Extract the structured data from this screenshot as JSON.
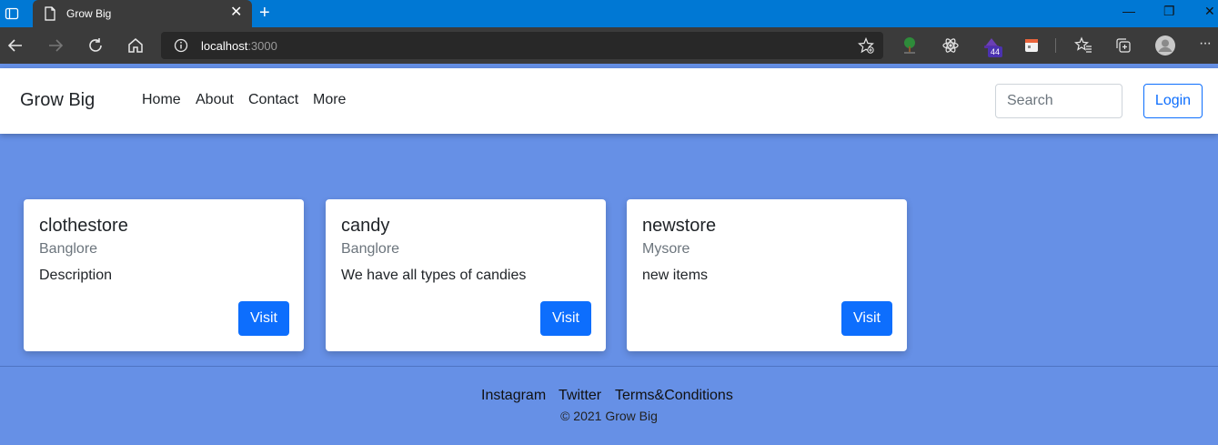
{
  "browser": {
    "tab_title": "Grow Big",
    "tab_close": "✕",
    "new_tab": "+",
    "url_host": "localhost",
    "url_port": ":3000",
    "extension_badge": "44",
    "window_controls": {
      "minimize": "—",
      "restore": "❐",
      "close": "✕"
    },
    "more": "···"
  },
  "navbar": {
    "brand": "Grow Big",
    "links": [
      "Home",
      "About",
      "Contact",
      "More"
    ],
    "search_placeholder": "Search",
    "login": "Login"
  },
  "cards": [
    {
      "title": "clothestore",
      "location": "Banglore",
      "description": "Description",
      "button": "Visit"
    },
    {
      "title": "candy",
      "location": "Banglore",
      "description": "We have all types of candies",
      "button": "Visit"
    },
    {
      "title": "newstore",
      "location": "Mysore",
      "description": "new items",
      "button": "Visit"
    }
  ],
  "footer": {
    "links": [
      "Instagram",
      "Twitter",
      "Terms&Conditions"
    ],
    "copyright": "© 2021 Grow Big"
  },
  "colors": {
    "page_background": "#6690e6",
    "primary": "#0d6efd",
    "tabstrip": "#0078d4",
    "toolbar": "#3b3b3b"
  }
}
